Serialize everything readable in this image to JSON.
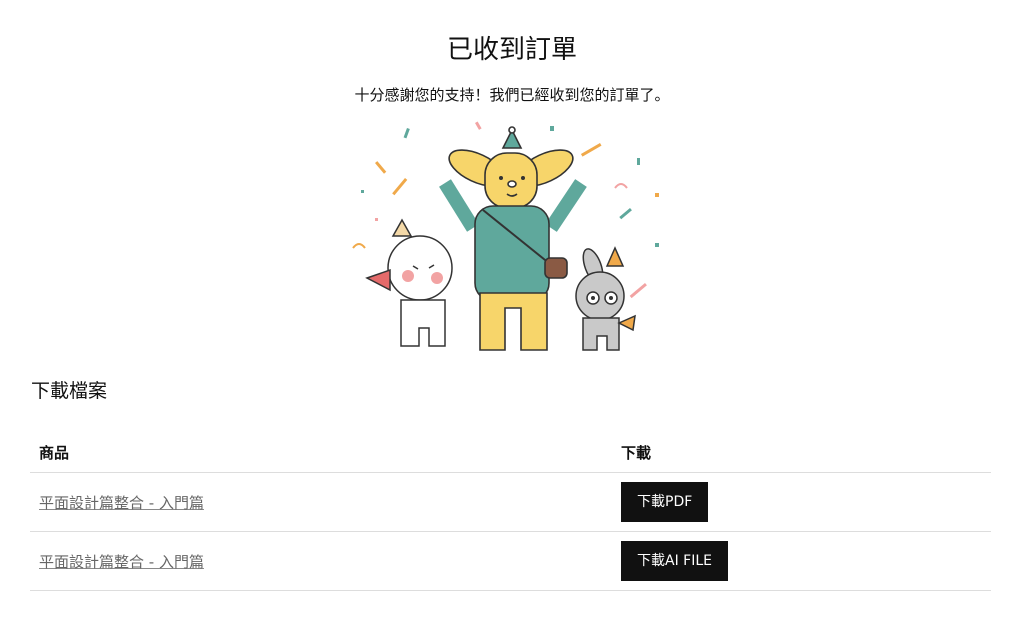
{
  "header": {
    "title": "已收到訂單",
    "subtitle": "十分感謝您的支持！我們已經收到您的訂單了。"
  },
  "illustration": {
    "icon": "celebration-characters-illustration",
    "colors": {
      "yellow": "#f7d56a",
      "teal": "#5fa89c",
      "gray": "#c9c9c9",
      "pink": "#f2a3a3",
      "orange": "#f0a94a"
    }
  },
  "downloads": {
    "heading": "下載檔案",
    "columns": {
      "product": "商品",
      "download": "下載"
    },
    "rows": [
      {
        "product": "平面設計篇整合 - 入門篇",
        "button": "下載PDF"
      },
      {
        "product": "平面設計篇整合 - 入門篇",
        "button": "下載AI FILE"
      }
    ]
  }
}
